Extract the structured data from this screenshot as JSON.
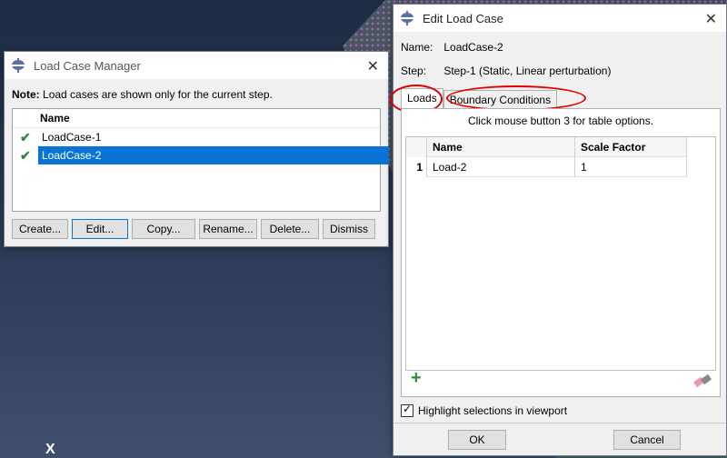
{
  "viewport": {
    "axis_label": "X"
  },
  "load_case_manager": {
    "title": "Load Case Manager",
    "note_label": "Note:",
    "note_text": "Load cases are shown only for the current step.",
    "column_header": "Name",
    "rows": [
      {
        "name": "LoadCase-1",
        "selected": false
      },
      {
        "name": "LoadCase-2",
        "selected": true
      }
    ],
    "buttons": {
      "create": "Create...",
      "edit": "Edit...",
      "copy": "Copy...",
      "rename": "Rename...",
      "delete": "Delete...",
      "dismiss": "Dismiss"
    }
  },
  "edit_load_case": {
    "title": "Edit Load Case",
    "name_label": "Name:",
    "name_value": "LoadCase-2",
    "step_label": "Step:",
    "step_value": "Step-1 (Static, Linear perturbation)",
    "tabs": {
      "loads": "Loads",
      "boundary": "Boundary Conditions"
    },
    "hint": "Click mouse button 3 for table options.",
    "table": {
      "headers": {
        "name": "Name",
        "scale": "Scale Factor"
      },
      "rows": [
        {
          "index": "1",
          "name": "Load-2",
          "scale": "1"
        }
      ]
    },
    "highlight_label": "Highlight selections in viewport",
    "buttons": {
      "ok": "OK",
      "cancel": "Cancel"
    }
  },
  "colors": {
    "selection": "#0a74d6",
    "annotation": "#e00000",
    "check": "#2e8b3a"
  }
}
